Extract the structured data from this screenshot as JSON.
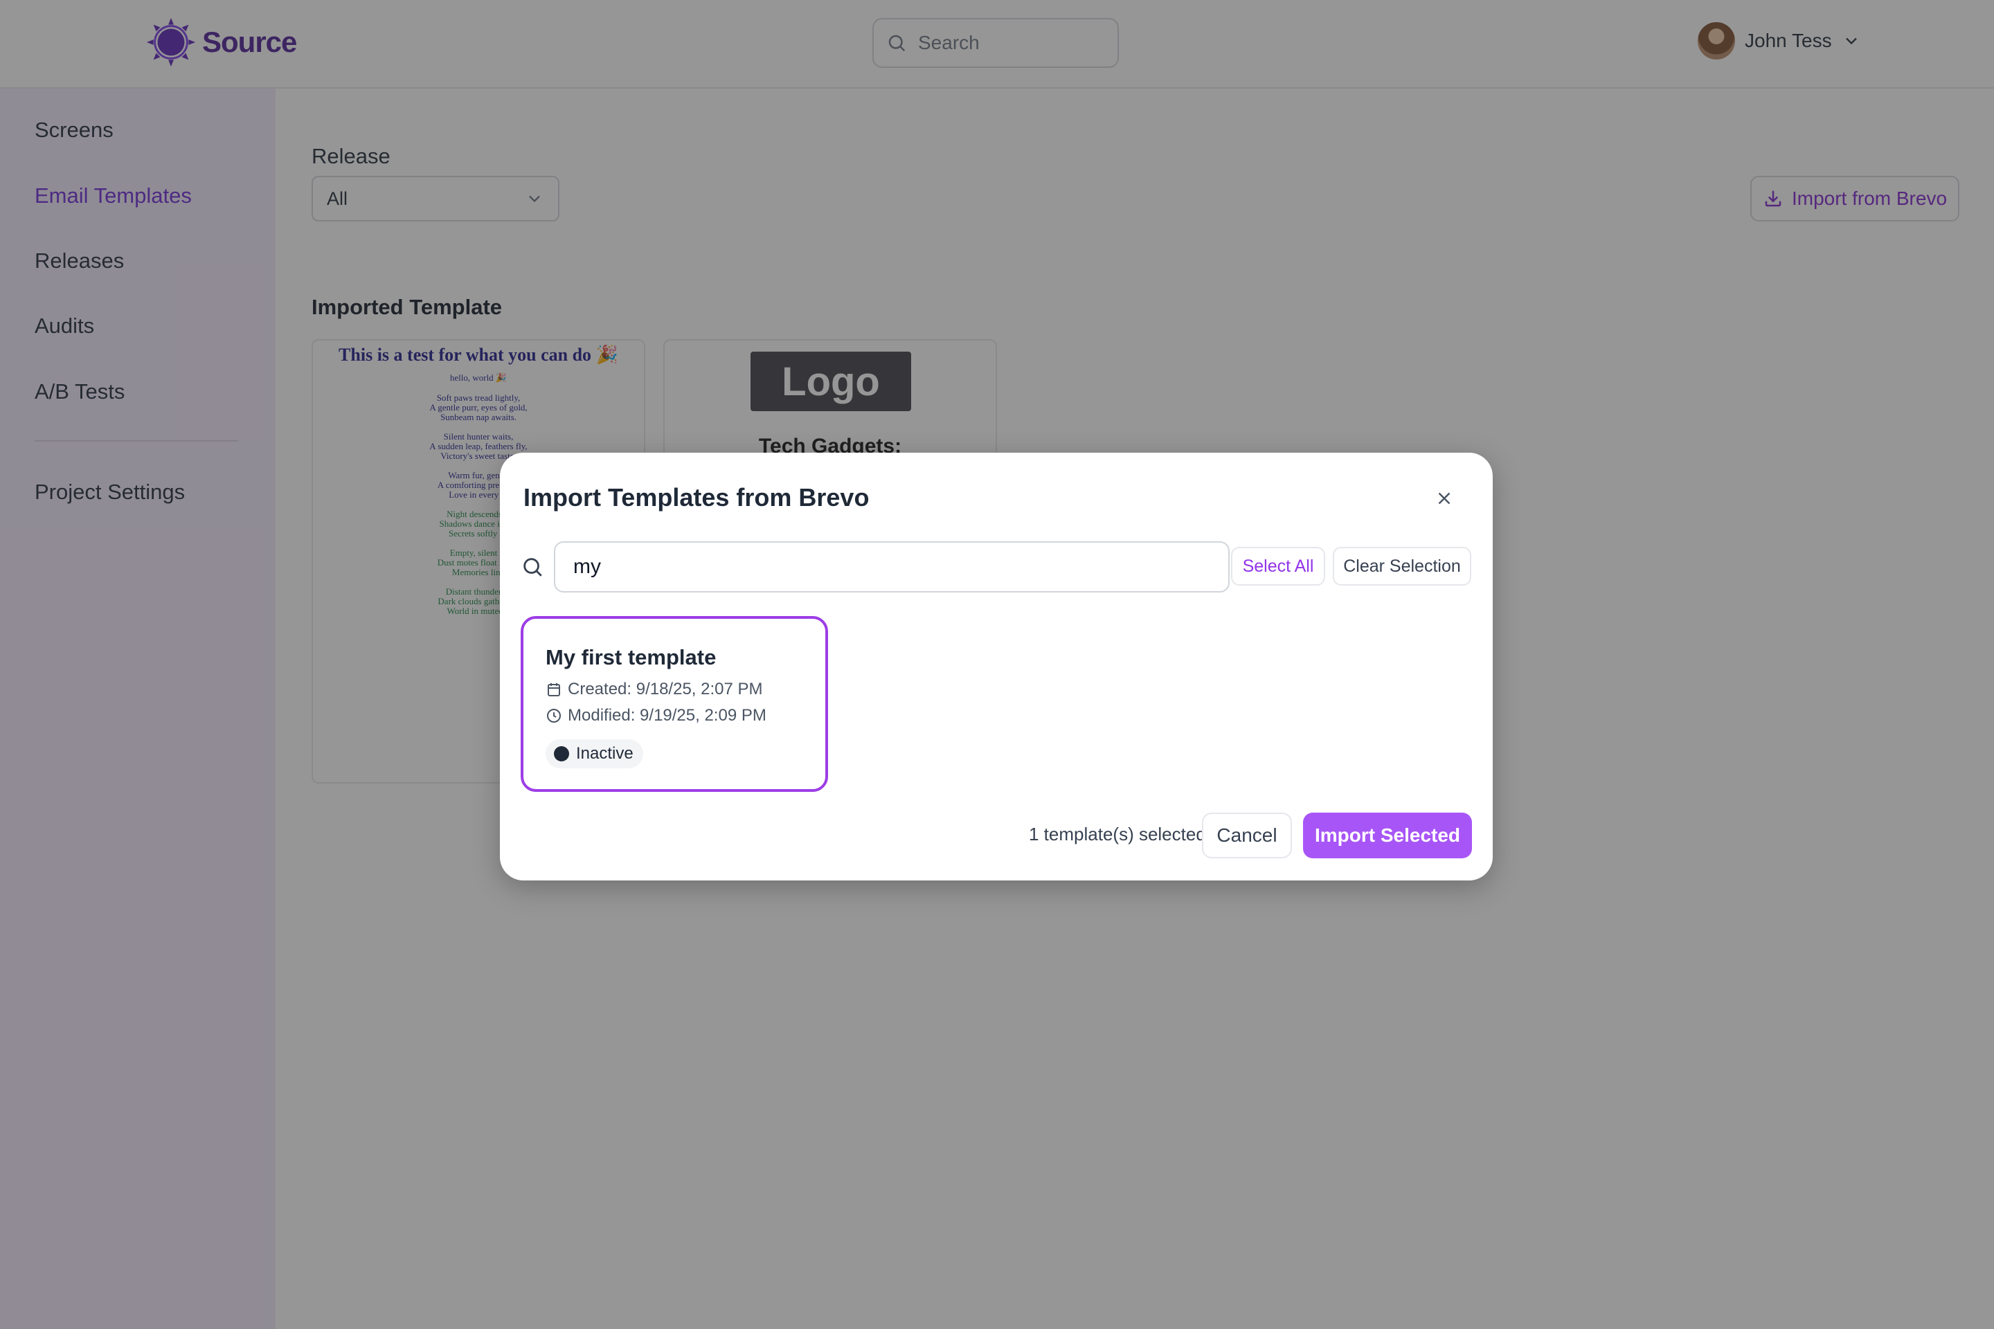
{
  "header": {
    "brand": "Source",
    "search_placeholder": "Search",
    "user_name": "John Tess"
  },
  "sidebar": {
    "items": [
      {
        "label": "Screens",
        "active": false
      },
      {
        "label": "Email Templates",
        "active": true
      },
      {
        "label": "Releases",
        "active": false
      },
      {
        "label": "Audits",
        "active": false
      },
      {
        "label": "A/B Tests",
        "active": false
      }
    ],
    "settings_label": "Project Settings"
  },
  "main": {
    "release_label": "Release",
    "release_value": "All",
    "import_button": "Import from Brevo",
    "section_title": "Imported Template",
    "cards": [
      {
        "title": "This is a test for what you can do 🎉",
        "greeting": "hello, world 🎉",
        "stanzas": [
          [
            "Soft paws tread lightly,",
            "A gentle purr, eyes of gold,",
            "Sunbeam nap awaits."
          ],
          [
            "Silent hunter waits,",
            "A sudden leap, feathers fly,",
            "Victory's sweet taste."
          ],
          [
            "Warm fur, gentle",
            "A comforting presence",
            "Love in every bl"
          ],
          [
            "Night descends sl",
            "Shadows dance in the",
            "Secrets softly ke"
          ],
          [
            "Empty, silent ro",
            "Dust motes float in the",
            "Memories ling"
          ],
          [
            "Distant thunder gr",
            "Dark clouds gather, be",
            "World in muted g"
          ]
        ]
      },
      {
        "logo": "Logo",
        "heading": "Tech Gadgets:"
      }
    ]
  },
  "modal": {
    "title": "Import Templates from Brevo",
    "search_value": "my",
    "select_all": "Select All",
    "clear_selection": "Clear Selection",
    "template": {
      "name": "My first template",
      "created": "Created: 9/18/25, 2:07 PM",
      "modified": "Modified: 9/19/25, 2:09 PM",
      "status": "Inactive"
    },
    "selected_count": "1 template(s) selected",
    "cancel": "Cancel",
    "import_selected": "Import Selected"
  },
  "colors": {
    "accent": "#9333ea",
    "accent_button": "#a855f7",
    "brand": "#4c1d95",
    "sidebar_bg": "#f3eafc"
  }
}
